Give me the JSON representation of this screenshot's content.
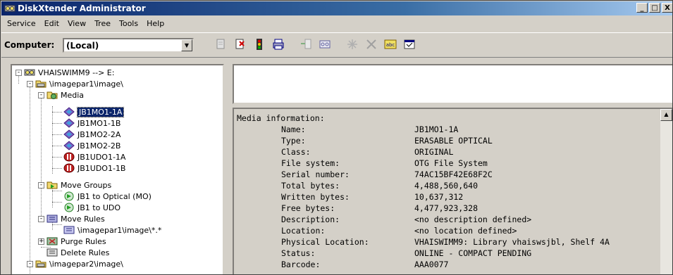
{
  "window": {
    "title": "DiskXtender Administrator",
    "minimize": "_",
    "maximize": "□",
    "close": "X"
  },
  "menu": [
    "Service",
    "Edit",
    "View",
    "Tree",
    "Tools",
    "Help"
  ],
  "toolbar": {
    "computer_label": "Computer:",
    "computer_value": "(Local)"
  },
  "tree": [
    {
      "label": "VHAISWIMM9 --> E:",
      "icon": "server-icon",
      "level": 0,
      "expander": "-"
    },
    {
      "label": "\\imagepar1\\image\\",
      "icon": "drive-icon",
      "level": 1,
      "expander": "-"
    },
    {
      "label": "Media",
      "icon": "media-folder-icon",
      "level": 2,
      "expander": "-"
    },
    {
      "label": "JB1MO1-1A",
      "icon": "optical-disc-icon",
      "level": 3,
      "expander": "",
      "selected": true
    },
    {
      "label": "JB1MO1-1B",
      "icon": "optical-disc-icon",
      "level": 3,
      "expander": ""
    },
    {
      "label": "JB1MO2-2A",
      "icon": "optical-disc-icon",
      "level": 3,
      "expander": ""
    },
    {
      "label": "JB1MO2-2B",
      "icon": "optical-disc-icon",
      "level": 3,
      "expander": ""
    },
    {
      "label": "JB1UDO1-1A",
      "icon": "udo-disc-icon",
      "level": 3,
      "expander": ""
    },
    {
      "label": "JB1UDO1-1B",
      "icon": "udo-disc-icon",
      "level": 3,
      "expander": ""
    },
    {
      "label": "Move Groups",
      "icon": "move-groups-icon",
      "level": 2,
      "expander": "-"
    },
    {
      "label": "JB1 to Optical (MO)",
      "icon": "move-group-icon",
      "level": 3,
      "expander": ""
    },
    {
      "label": "JB1 to UDO",
      "icon": "move-group-icon",
      "level": 3,
      "expander": ""
    },
    {
      "label": "Move Rules",
      "icon": "move-rules-icon",
      "level": 2,
      "expander": "-"
    },
    {
      "label": "\\imagepar1\\image\\*.*",
      "icon": "rule-icon",
      "level": 3,
      "expander": ""
    },
    {
      "label": "Purge Rules",
      "icon": "purge-rules-icon",
      "level": 2,
      "expander": "+"
    },
    {
      "label": "Delete Rules",
      "icon": "delete-rules-icon",
      "level": 2,
      "expander": ""
    },
    {
      "label": "\\imagepar2\\image\\",
      "icon": "drive-icon",
      "level": 1,
      "expander": "-"
    }
  ],
  "info": {
    "heading": "Media information:",
    "rows": [
      {
        "label": "Name:",
        "value": "JB1MO1-1A"
      },
      {
        "label": "Type:",
        "value": "ERASABLE OPTICAL"
      },
      {
        "label": "Class:",
        "value": "ORIGINAL"
      },
      {
        "label": "File system:",
        "value": "OTG File System"
      },
      {
        "label": "Serial number:",
        "value": "74AC15BF42E68F2C"
      },
      {
        "label": "Total bytes:",
        "value": "4,488,560,640"
      },
      {
        "label": "Written bytes:",
        "value": "10,637,312"
      },
      {
        "label": "Free bytes:",
        "value": "4,477,923,328"
      },
      {
        "label": "Description:",
        "value": "<no description defined>"
      },
      {
        "label": "Location:",
        "value": "<no location defined>"
      },
      {
        "label": "Physical Location:",
        "value": "VHAISWIMM9: Library vhaiswsjbl, Shelf 4A"
      },
      {
        "label": "Status:",
        "value": "ONLINE - COMPACT PENDING"
      },
      {
        "label": "Barcode:",
        "value": "AAA0077"
      }
    ]
  }
}
